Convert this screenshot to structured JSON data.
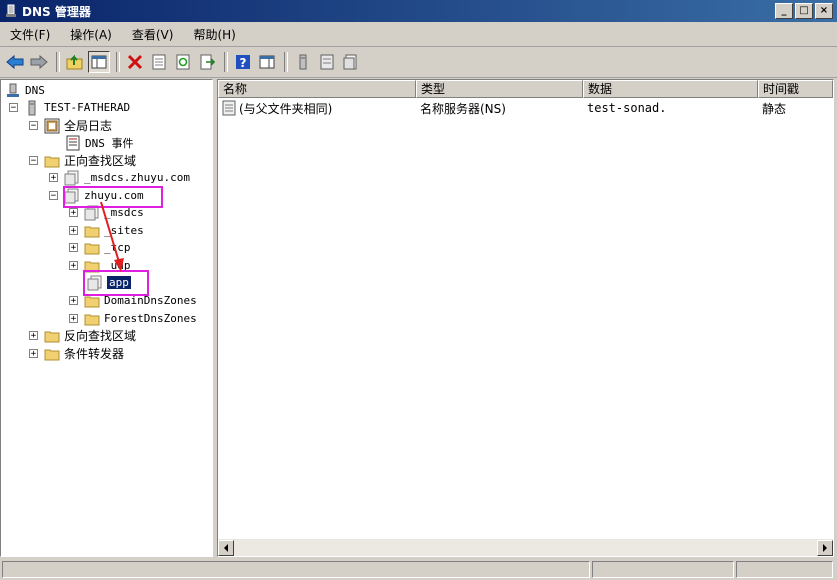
{
  "window": {
    "title": "DNS 管理器",
    "buttons": {
      "minimize": "_",
      "maximize": "□",
      "close": "×"
    }
  },
  "menu": {
    "items": [
      "文件(F)",
      "操作(A)",
      "查看(V)",
      "帮助(H)"
    ]
  },
  "tree": {
    "root": "DNS",
    "server": "TEST-FATHERAD",
    "global_logs": "全局日志",
    "dns_events": "DNS 事件",
    "forward_zones": "正向查找区域",
    "msdcs_zone": "_msdcs.zhuyu.com",
    "zhuyu_zone": "zhuyu.com",
    "sub": {
      "msdcs": "_msdcs",
      "sites": "_sites",
      "tcp": "_tcp",
      "udp": "_udp",
      "app": "app",
      "domain_dns": "DomainDnsZones",
      "forest_dns": "ForestDnsZones"
    },
    "reverse_zones": "反向查找区域",
    "forwarders": "条件转发器"
  },
  "list": {
    "columns": [
      "名称",
      "类型",
      "数据",
      "时间戳"
    ],
    "rows": [
      {
        "name": "(与父文件夹相同)",
        "type": "名称服务器(NS)",
        "data": "test-sonad.",
        "timestamp": "静态"
      }
    ]
  },
  "colors": {
    "highlight": "#e01ee0",
    "arrow": "#e02020",
    "selection": "#0a246a"
  }
}
